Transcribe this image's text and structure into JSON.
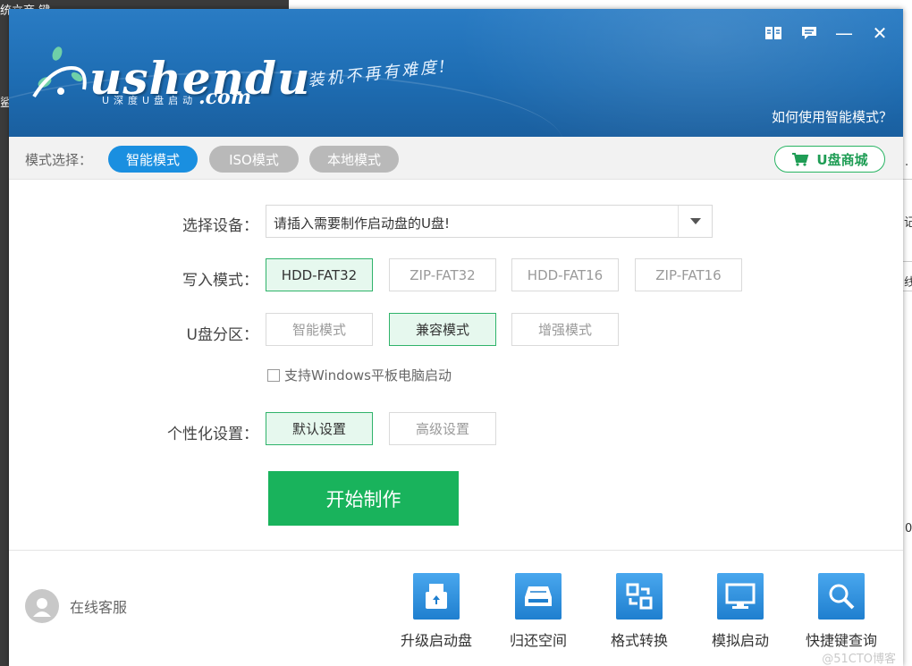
{
  "background": {
    "frag_top_left": "统立商 键",
    "frag_left": "鲨",
    "frag_r1": "·",
    "frag_r2": "记",
    "frag_r3": "线",
    "frag_r4": "0"
  },
  "window": {
    "brand": "ushendu",
    "brand_sub": "U深度U盘启动",
    "brand_com": ".com",
    "slogan": "装机不再有难度!",
    "help_link": "如何使用智能模式？",
    "controls": {
      "book": "book-icon",
      "chat": "message-icon",
      "minimize": "—",
      "close": "✕"
    }
  },
  "modebar": {
    "label": "模式选择：",
    "modes": [
      {
        "label": "智能模式",
        "active": true
      },
      {
        "label": "ISO模式",
        "active": false
      },
      {
        "label": "本地模式",
        "active": false
      }
    ],
    "shop": "U盘商城"
  },
  "form": {
    "device_label": "选择设备：",
    "device_value": "请插入需要制作启动盘的U盘!",
    "write_label": "写入模式：",
    "write_modes": [
      "HDD-FAT32",
      "ZIP-FAT32",
      "HDD-FAT16",
      "ZIP-FAT16"
    ],
    "write_selected": "HDD-FAT32",
    "partition_label": "U盘分区：",
    "partition_modes": [
      "智能模式",
      "兼容模式",
      "增强模式"
    ],
    "partition_selected": "兼容模式",
    "tablet_checkbox": "支持Windows平板电脑启动",
    "tablet_checked": false,
    "personal_label": "个性化设置：",
    "personal_modes": [
      "默认设置",
      "高级设置"
    ],
    "personal_selected": "默认设置",
    "start_button": "开始制作"
  },
  "footer": {
    "service": "在线客服",
    "tools": [
      "升级启动盘",
      "归还空间",
      "格式转换",
      "模拟启动",
      "快捷键查询"
    ],
    "watermark": "@51CTO博客"
  },
  "colors": {
    "primary_blue": "#1a8fe0",
    "green": "#19b35c",
    "header_blue": "#1e6db3"
  }
}
